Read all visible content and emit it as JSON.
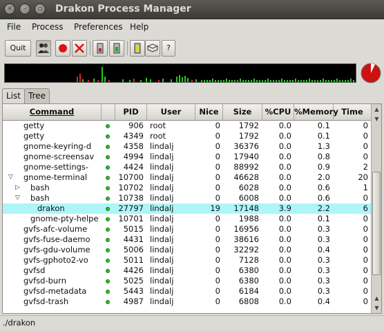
{
  "window": {
    "title": "Drakon Process Manager"
  },
  "menu": [
    "File",
    "Process",
    "Preferences",
    "Help"
  ],
  "toolbar": {
    "quit_label": "Quit",
    "icons": [
      "users-icon",
      "record-icon",
      "kill-icon",
      "meter-icon",
      "meter-green-icon",
      "meter-yellow-icon",
      "book-icon",
      "help-icon"
    ],
    "help_label": "?"
  },
  "tabs": [
    "List",
    "Tree"
  ],
  "table": {
    "columns": [
      "Command",
      "",
      "PID",
      "User",
      "Nice",
      "Size",
      "%CPU",
      "%Memory",
      "Time"
    ],
    "rows": [
      {
        "command": "getty",
        "indent": 0,
        "expander": "",
        "pid": "906",
        "user": "root",
        "nice": "0",
        "size": "1792",
        "cpu": "0.0",
        "mem": "0.1",
        "time": "0",
        "selected": false
      },
      {
        "command": "getty",
        "indent": 0,
        "expander": "",
        "pid": "4349",
        "user": "root",
        "nice": "0",
        "size": "1792",
        "cpu": "0.0",
        "mem": "0.1",
        "time": "0",
        "selected": false
      },
      {
        "command": "gnome-keyring-d",
        "indent": 0,
        "expander": "",
        "pid": "4358",
        "user": "lindalj",
        "nice": "0",
        "size": "36376",
        "cpu": "0.0",
        "mem": "1.3",
        "time": "0",
        "selected": false
      },
      {
        "command": "gnome-screensav",
        "indent": 0,
        "expander": "",
        "pid": "4994",
        "user": "lindalj",
        "nice": "0",
        "size": "17940",
        "cpu": "0.0",
        "mem": "0.8",
        "time": "0",
        "selected": false
      },
      {
        "command": "gnome-settings-",
        "indent": 0,
        "expander": "",
        "pid": "4424",
        "user": "lindalj",
        "nice": "0",
        "size": "88992",
        "cpu": "0.0",
        "mem": "0.9",
        "time": "2",
        "selected": false
      },
      {
        "command": "gnome-terminal",
        "indent": 0,
        "expander": "open",
        "pid": "10700",
        "user": "lindalj",
        "nice": "0",
        "size": "46628",
        "cpu": "0.0",
        "mem": "2.0",
        "time": "20",
        "selected": false
      },
      {
        "command": "bash",
        "indent": 1,
        "expander": "closed",
        "pid": "10702",
        "user": "lindalj",
        "nice": "0",
        "size": "6028",
        "cpu": "0.0",
        "mem": "0.6",
        "time": "1",
        "selected": false
      },
      {
        "command": "bash",
        "indent": 1,
        "expander": "open",
        "pid": "10738",
        "user": "lindalj",
        "nice": "0",
        "size": "6008",
        "cpu": "0.0",
        "mem": "0.6",
        "time": "0",
        "selected": false
      },
      {
        "command": "drakon",
        "indent": 2,
        "expander": "",
        "pid": "27797",
        "user": "lindalj",
        "nice": "19",
        "size": "17148",
        "cpu": "3.9",
        "mem": "2.2",
        "time": "6",
        "selected": true
      },
      {
        "command": "gnome-pty-helpe",
        "indent": 1,
        "expander": "",
        "pid": "10701",
        "user": "lindalj",
        "nice": "0",
        "size": "1988",
        "cpu": "0.0",
        "mem": "0.1",
        "time": "0",
        "selected": false
      },
      {
        "command": "gvfs-afc-volume",
        "indent": 0,
        "expander": "",
        "pid": "5015",
        "user": "lindalj",
        "nice": "0",
        "size": "16956",
        "cpu": "0.0",
        "mem": "0.3",
        "time": "0",
        "selected": false
      },
      {
        "command": "gvfs-fuse-daemo",
        "indent": 0,
        "expander": "",
        "pid": "4431",
        "user": "lindalj",
        "nice": "0",
        "size": "38616",
        "cpu": "0.0",
        "mem": "0.3",
        "time": "0",
        "selected": false
      },
      {
        "command": "gvfs-gdu-volume",
        "indent": 0,
        "expander": "",
        "pid": "5006",
        "user": "lindalj",
        "nice": "0",
        "size": "32292",
        "cpu": "0.0",
        "mem": "0.4",
        "time": "0",
        "selected": false
      },
      {
        "command": "gvfs-gphoto2-vo",
        "indent": 0,
        "expander": "",
        "pid": "5011",
        "user": "lindalj",
        "nice": "0",
        "size": "7128",
        "cpu": "0.0",
        "mem": "0.3",
        "time": "0",
        "selected": false
      },
      {
        "command": "gvfsd",
        "indent": 0,
        "expander": "",
        "pid": "4426",
        "user": "lindalj",
        "nice": "0",
        "size": "6380",
        "cpu": "0.0",
        "mem": "0.3",
        "time": "0",
        "selected": false
      },
      {
        "command": "gvfsd-burn",
        "indent": 0,
        "expander": "",
        "pid": "5025",
        "user": "lindalj",
        "nice": "0",
        "size": "6380",
        "cpu": "0.0",
        "mem": "0.3",
        "time": "0",
        "selected": false
      },
      {
        "command": "gvfsd-metadata",
        "indent": 0,
        "expander": "",
        "pid": "5443",
        "user": "lindalj",
        "nice": "0",
        "size": "6184",
        "cpu": "0.0",
        "mem": "0.3",
        "time": "0",
        "selected": false
      },
      {
        "command": "gvfsd-trash",
        "indent": 0,
        "expander": "",
        "pid": "4987",
        "user": "lindalj",
        "nice": "0",
        "size": "6808",
        "cpu": "0.0",
        "mem": "0.4",
        "time": "0",
        "selected": false
      }
    ]
  },
  "status": {
    "text": "./drakon"
  },
  "colors": {
    "selected_row": "#aef5f8",
    "status_dot": "#2dbd2d",
    "graph_green": "#22cc22",
    "graph_red": "#dd2222",
    "pie_red": "#cc1111"
  }
}
